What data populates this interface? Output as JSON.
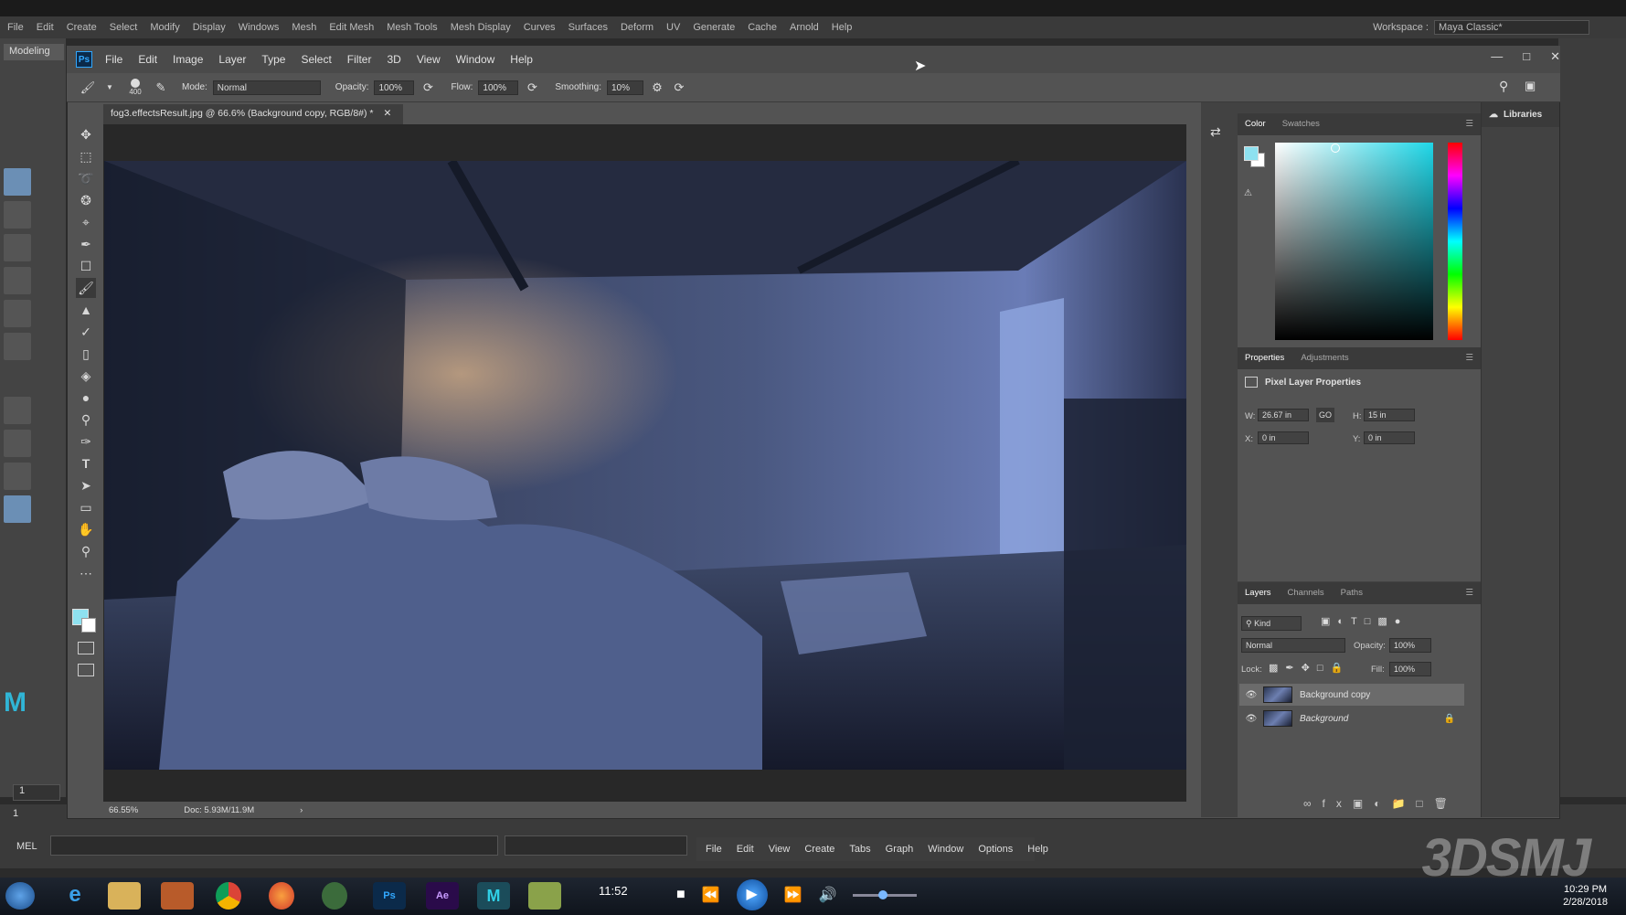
{
  "maya": {
    "menu": [
      "File",
      "Edit",
      "Create",
      "Select",
      "Modify",
      "Display",
      "Windows",
      "Mesh",
      "Edit Mesh",
      "Mesh Tools",
      "Mesh Display",
      "Curves",
      "Surfaces",
      "Deform",
      "UV",
      "Generate",
      "Cache",
      "Arnold",
      "Help"
    ],
    "workspace_label": "Workspace :",
    "workspace_value": "Maya Classic*",
    "shelf_label": "Modeling",
    "mel_label": "MEL",
    "timeline_start": "1",
    "frame_field": "1",
    "hypershade_menu": [
      "File",
      "Edit",
      "View",
      "Create",
      "Tabs",
      "Graph",
      "Window",
      "Options",
      "Help"
    ]
  },
  "ps": {
    "logo": "Ps",
    "menu": [
      "File",
      "Edit",
      "Image",
      "Layer",
      "Type",
      "Select",
      "Filter",
      "3D",
      "View",
      "Window",
      "Help"
    ],
    "options": {
      "brush_size": "400",
      "mode_label": "Mode:",
      "mode_value": "Normal",
      "opacity_label": "Opacity:",
      "opacity_value": "100%",
      "flow_label": "Flow:",
      "flow_value": "100%",
      "smoothing_label": "Smoothing:",
      "smoothing_value": "10%"
    },
    "doc_tab": "fog3.effectsResult.jpg @ 66.6% (Background copy, RGB/8#) *",
    "status": {
      "zoom": "66.55%",
      "doc": "Doc: 5.93M/11.9M"
    },
    "color_panel": {
      "tabs": [
        "Color",
        "Swatches"
      ],
      "fg": "#8ee1f0",
      "bg": "#ffffff"
    },
    "libraries_label": "Libraries",
    "properties": {
      "tabs": [
        "Properties",
        "Adjustments"
      ],
      "title": "Pixel Layer Properties",
      "w_label": "W:",
      "w_value": "26.67 in",
      "h_label": "H:",
      "h_value": "15 in",
      "x_label": "X:",
      "x_value": "0 in",
      "y_label": "Y:",
      "y_value": "0 in"
    },
    "layers": {
      "tabs": [
        "Layers",
        "Channels",
        "Paths"
      ],
      "kind": "Kind",
      "blend": "Normal",
      "opacity_label": "Opacity:",
      "opacity_value": "100%",
      "lock_label": "Lock:",
      "fill_label": "Fill:",
      "fill_value": "100%",
      "items": [
        "Background copy",
        "Background"
      ]
    }
  },
  "taskbar": {
    "media_time": "11:52",
    "clock_time": "10:29 PM",
    "clock_date": "2/28/2018"
  },
  "watermark": "3DSMJ"
}
